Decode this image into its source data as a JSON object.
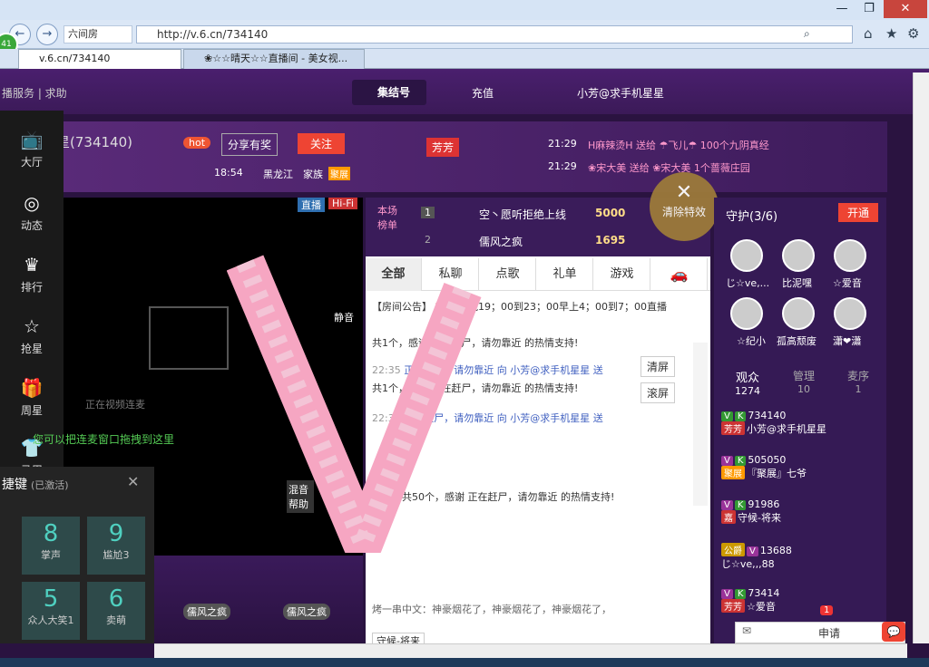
{
  "browser": {
    "url": "http://v.6.cn/734140",
    "site_chip": "六间房",
    "tab1": "v.6.cn/734140",
    "tab2": "❀☆☆晴天☆☆直播间 - 美女视...",
    "nav_badge": "41"
  },
  "header": {
    "left_links": "播服务 | 求助",
    "gather": "集结号",
    "recharge": "充值",
    "user": "小芳@求手机星星"
  },
  "room": {
    "title": "求手机星星(734140)",
    "hot": "hot",
    "share": "分享有奖",
    "follow": "关注",
    "time": "18:54",
    "place": "黑龙江",
    "family": "家族",
    "family_badge": "聚展",
    "tag": "芳芳"
  },
  "feed": [
    {
      "time": "21:29",
      "text": "H麻辣烫H 送给 ☂飞儿☂ 100个九阴真经"
    },
    {
      "time": "21:29",
      "text": "❀宋大美 送给 ❀宋大美 1个蔷薇庄园"
    }
  ],
  "sidebar": [
    "大厅",
    "动态",
    "排行",
    "抢星",
    "周星",
    "马甲"
  ],
  "video": {
    "live": "直播",
    "hifi": "Hi-Fi",
    "waiting": "正在视频连麦",
    "drag_tip": "您可以把连麦窗口拖拽到这里",
    "mute": "静音",
    "help": "混音帮助",
    "seat1": "儒风之疯",
    "seat2": "儒风之疯"
  },
  "shortcut": {
    "title": "捷键",
    "status": "(已激活)",
    "keys": [
      {
        "n": "8",
        "label": "掌声"
      },
      {
        "n": "9",
        "label": "尴尬3"
      },
      {
        "n": "5",
        "label": "众人大笑1"
      },
      {
        "n": "6",
        "label": "卖萌"
      }
    ]
  },
  "rank": {
    "label": "本场榜单",
    "r1": {
      "num": "1",
      "name": "空丶愿听拒绝上线",
      "score": "5000"
    },
    "r2": {
      "num": "2",
      "name": "儒风之疯",
      "score": "1695"
    }
  },
  "chat_tabs": [
    "全部",
    "私聊",
    "点歌",
    "礼单",
    "游戏"
  ],
  "chat": {
    "announce": "【房间公告】",
    "recharge": "充值",
    "schedule": "每晚19；00到23；00早上4；00到7；00直播",
    "line1": "共1个，感谢 正在赶尸，请勿靠近 的热情支持!",
    "line2_time": "22:35",
    "line2": "正在赶尸，请勿靠近 向 小芳@求手机星星 送",
    "line3": "共1个，感谢 正在赶尸，请勿靠近 的热情支持!",
    "line4_time": "22:36",
    "line4": "正在赶尸，请勿靠近 向 小芳@求手机星星 送",
    "line5": "猪头，共50个，感谢 正在赶尸，请勿靠近 的热情支持!",
    "clear": "清屏",
    "scroll": "滚屏",
    "broadcast": "烤一串中文：神豪烟花了，神豪烟花了，神豪烟花了，",
    "input_tag": "守候-将来",
    "clear_effect": "清除特效"
  },
  "right": {
    "guard_title": "守护(3/6)",
    "open": "开通",
    "guards": [
      "じ☆ve,...",
      "比泥嘿",
      "☆爱音",
      "☆纪小",
      "孤高颓废",
      "瀟❤瀟"
    ],
    "tabs": [
      {
        "label": "观众",
        "count": "1274"
      },
      {
        "label": "管理",
        "count": "10"
      },
      {
        "label": "麦序",
        "count": "1"
      }
    ],
    "users": [
      {
        "id": "734140",
        "name": "小芳@求手机星星",
        "tag": "芳芳"
      },
      {
        "id": "505050",
        "name": "『聚展』七爷",
        "tag": "聚展"
      },
      {
        "id": "91986",
        "name": "守候-将来",
        "tag": "嘉"
      },
      {
        "id": "13688",
        "name": "じ☆ve,,,88",
        "tag": "公爵"
      },
      {
        "id": "73414",
        "name": "☆爱音",
        "tag": "芳芳"
      }
    ],
    "apply": "申请",
    "msg_count": "1"
  }
}
